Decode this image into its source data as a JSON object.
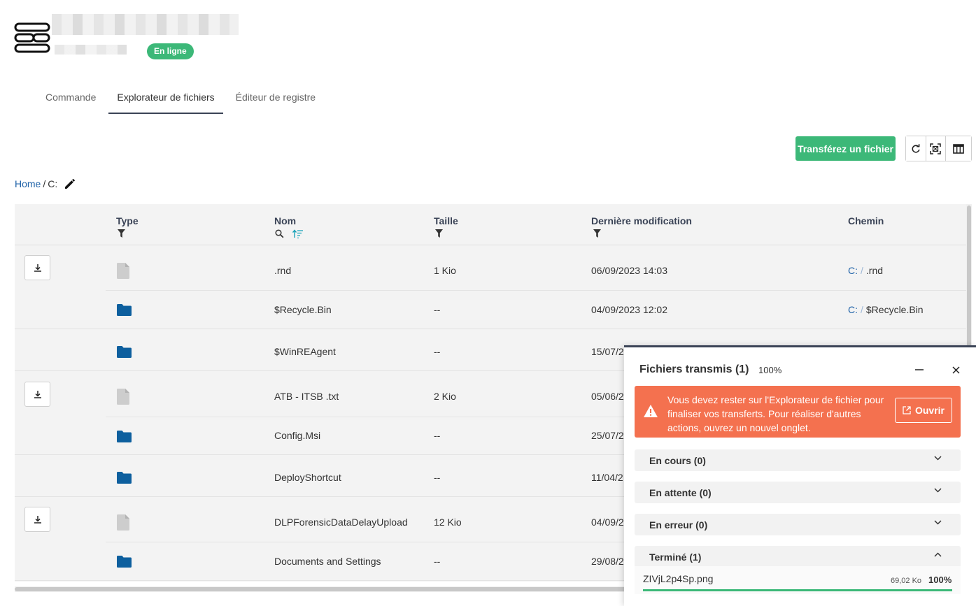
{
  "header": {
    "status_badge": "En ligne"
  },
  "tabs": [
    {
      "label": "Commande",
      "active": false
    },
    {
      "label": "Explorateur de fichiers",
      "active": true
    },
    {
      "label": "Éditeur de registre",
      "active": false
    }
  ],
  "toolbar": {
    "upload_label": "Transférez un fichier",
    "icons": [
      "refresh-icon",
      "fit-screen-icon",
      "columns-icon"
    ]
  },
  "breadcrumb": {
    "home": "Home",
    "separator": "/",
    "current": "C:"
  },
  "table": {
    "columns": {
      "type": "Type",
      "name": "Nom",
      "size": "Taille",
      "modified": "Dernière modification",
      "path": "Chemin"
    },
    "rows": [
      {
        "type": "file",
        "name": ".rnd",
        "size": "1 Kio",
        "modified": "06/09/2023 14:03",
        "path_root": "C:",
        "path_sep": "/",
        "path_name": ".rnd"
      },
      {
        "type": "folder",
        "name": "$Recycle.Bin",
        "size": "--",
        "modified": "04/09/2023 12:02",
        "path_root": "C:",
        "path_sep": "/",
        "path_name": "$Recycle.Bin"
      },
      {
        "type": "folder",
        "name": "$WinREAgent",
        "size": "--",
        "modified": "15/07/2"
      },
      {
        "type": "file",
        "name": "ATB - ITSB .txt",
        "size": "2 Kio",
        "modified": "05/06/2"
      },
      {
        "type": "folder",
        "name": "Config.Msi",
        "size": "--",
        "modified": "25/07/2"
      },
      {
        "type": "folder",
        "name": "DeployShortcut",
        "size": "--",
        "modified": "11/04/2"
      },
      {
        "type": "file",
        "name": "DLPForensicDataDelayUpload",
        "size": "12 Kio",
        "modified": "04/09/2"
      },
      {
        "type": "folder",
        "name": "Documents and Settings",
        "size": "--",
        "modified": "29/08/2"
      }
    ]
  },
  "transfer_panel": {
    "title": "Fichiers transmis (1)",
    "percent": "100%",
    "alert": {
      "text": "Vous devez rester sur l'Explorateur de fichier pour finaliser vos transferts. Pour réaliser d'autres actions, ouvrez un nouvel onglet.",
      "button": "Ouvrir"
    },
    "sections": [
      {
        "label": "En cours (0)",
        "expanded": false
      },
      {
        "label": "En attente (0)",
        "expanded": false
      },
      {
        "label": "En erreur (0)",
        "expanded": false
      },
      {
        "label": "Terminé (1)",
        "expanded": true
      }
    ],
    "completed_file": {
      "name": "ZIVjL2p4Sp.png",
      "size": "69,02 Ko",
      "percent": "100%",
      "progress": 1.0
    }
  },
  "colors": {
    "accent_green": "#3cb878",
    "link_blue": "#1f62a8",
    "folder_blue": "#0d5f9e",
    "alert_orange": "#f4714f"
  }
}
